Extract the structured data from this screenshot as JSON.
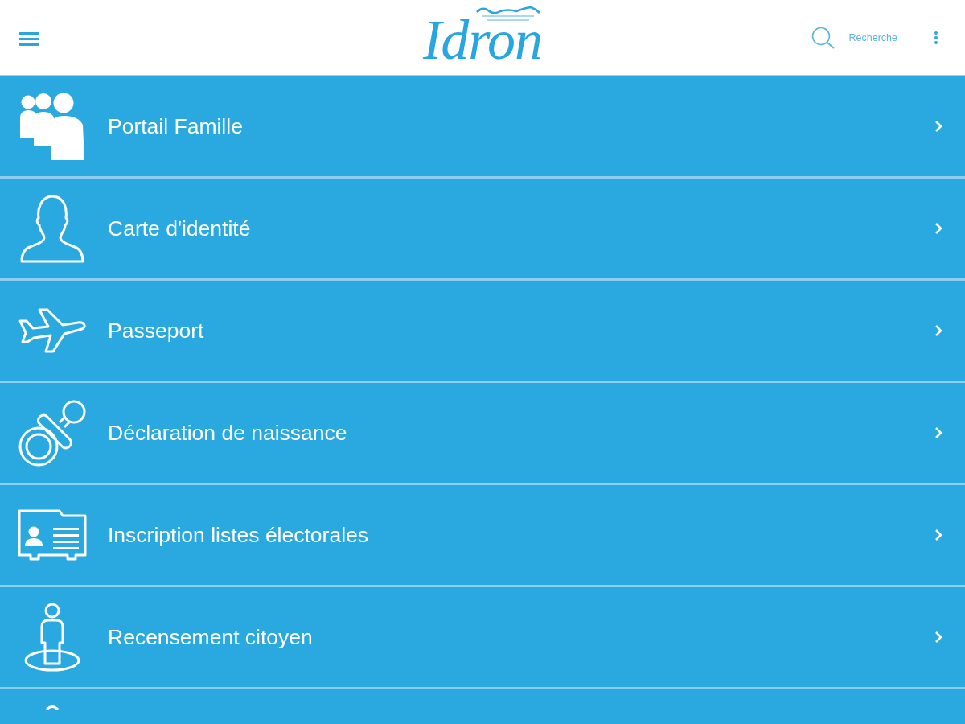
{
  "header": {
    "logo": "Idron",
    "search": {
      "label": "Recherche"
    }
  },
  "items": [
    {
      "kind": "family",
      "label": "Portail Famille"
    },
    {
      "kind": "person",
      "label": "Carte d'identité"
    },
    {
      "kind": "plane",
      "label": "Passeport"
    },
    {
      "kind": "pacifier",
      "label": "Déclaration de naissance"
    },
    {
      "kind": "card",
      "label": "Inscription listes électorales"
    },
    {
      "kind": "citizen",
      "label": "Recensement citoyen"
    },
    {
      "kind": "partial"
    }
  ]
}
